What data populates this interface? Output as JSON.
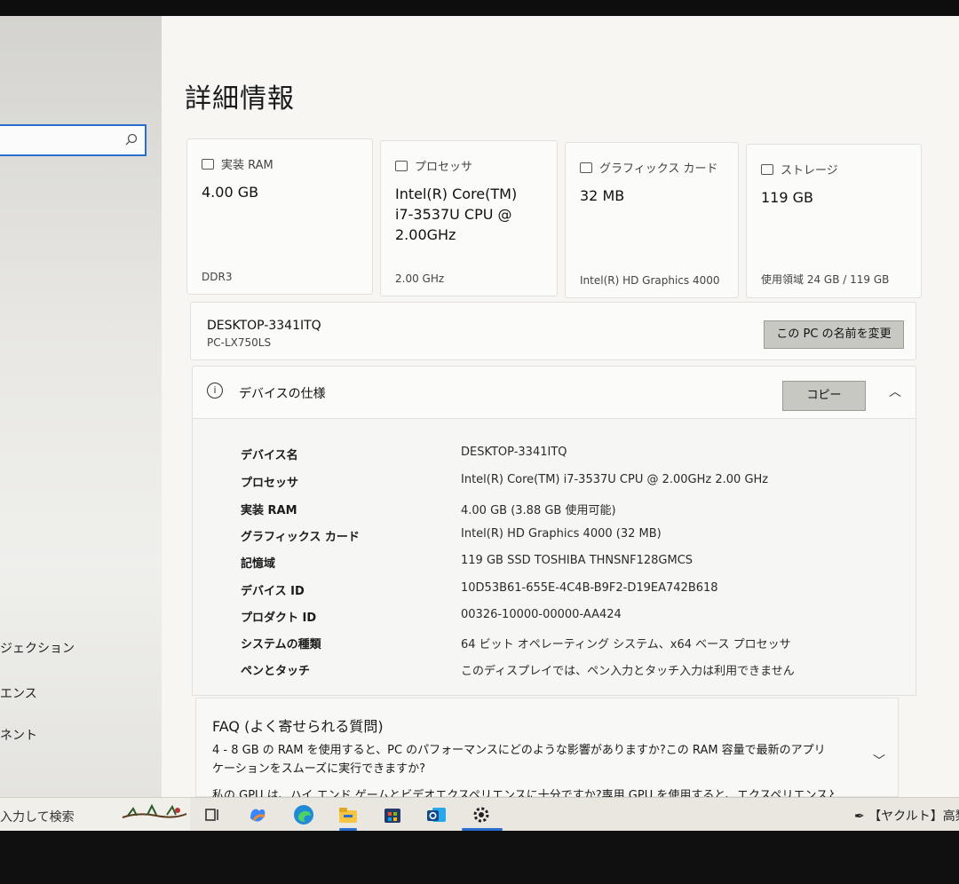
{
  "page": {
    "title": "詳細情報"
  },
  "sidebar": {
    "search_placeholder": "",
    "items": [
      {
        "label": "ジェクション"
      },
      {
        "label": "エンス"
      },
      {
        "label": "ネント"
      }
    ]
  },
  "cards": [
    {
      "header": "実装 RAM",
      "value": "4.00 GB",
      "sub": "DDR3",
      "icon": "memory-icon"
    },
    {
      "header": "プロセッサ",
      "value": "Intel(R) Core(TM) i7-3537U CPU @ 2.00GHz",
      "sub": "2.00 GHz",
      "icon": "processor-icon"
    },
    {
      "header": "グラフィックス カード",
      "value": "32 MB",
      "sub": "Intel(R) HD Graphics 4000",
      "icon": "display-icon"
    },
    {
      "header": "ストレージ",
      "value": "119 GB",
      "sub": "使用領域 24 GB / 119 GB",
      "icon": "storage-icon"
    }
  ],
  "pc": {
    "name": "DESKTOP-3341ITQ",
    "model": "PC-LX750LS",
    "rename_label": "この PC の名前を変更"
  },
  "device_spec": {
    "title": "デバイスの仕様",
    "copy_label": "コピー",
    "rows": [
      {
        "key": "デバイス名",
        "value": "DESKTOP-3341ITQ"
      },
      {
        "key": "プロセッサ",
        "value": "Intel(R) Core(TM) i7-3537U CPU @ 2.00GHz   2.00 GHz"
      },
      {
        "key": "実装 RAM",
        "value": "4.00 GB (3.88 GB 使用可能)"
      },
      {
        "key": "グラフィックス カード",
        "value": "Intel(R) HD Graphics 4000 (32 MB)"
      },
      {
        "key": "記憶域",
        "value": "119 GB SSD TOSHIBA THNSNF128GMCS"
      },
      {
        "key": "デバイス ID",
        "value": "10D53B61-655E-4C4B-B9F2-D19EA742B618"
      },
      {
        "key": "プロダクト ID",
        "value": "00326-10000-00000-AA424"
      },
      {
        "key": "システムの種類",
        "value": "64 ビット オペレーティング システム、x64 ベース プロセッサ"
      },
      {
        "key": "ペンとタッチ",
        "value": "このディスプレイでは、ペン入力とタッチ入力は利用できません"
      }
    ]
  },
  "faq": {
    "title": "FAQ (よく寄せられる質問)",
    "q1": "4 - 8 GB の RAM を使用すると、PC のパフォーマンスにどのような影響がありますか?この RAM 容量で最新のアプリケーションをスムーズに実行できますか?",
    "q2": "私の GPU は、ハイ エンド ゲームとビデオエクスペリエンスに十分ですか?専用 GPU を使用すると、エクスペリエンスと"
  },
  "taskbar": {
    "search_text": "入力して検索",
    "apps": [
      "task-view-icon",
      "copilot-icon",
      "edge-icon",
      "file-explorer-icon",
      "store-icon",
      "outlook-icon",
      "settings-icon"
    ],
    "right_text": "【ヤクルト】高梨"
  }
}
